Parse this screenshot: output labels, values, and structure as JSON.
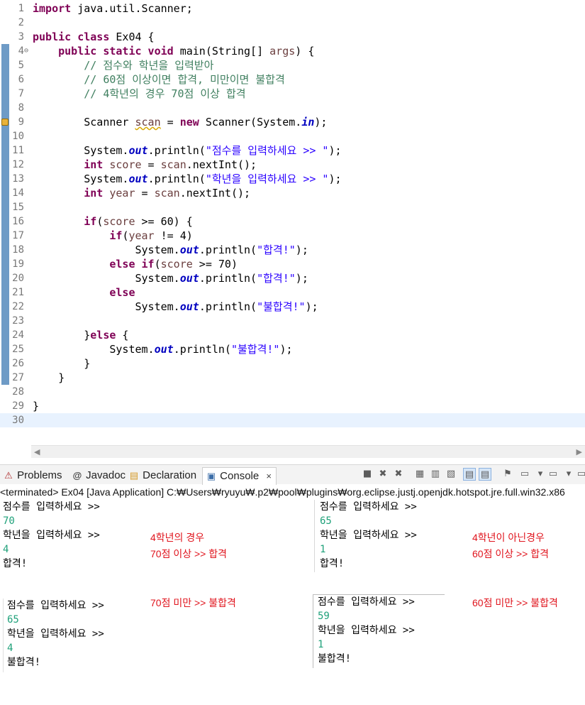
{
  "editor": {
    "lines": [
      {
        "n": "1",
        "tokens": [
          {
            "t": "import",
            "c": "kw"
          },
          {
            "t": " java.util.Scanner;",
            "c": ""
          }
        ]
      },
      {
        "n": "2",
        "tokens": []
      },
      {
        "n": "3",
        "tokens": [
          {
            "t": "public class",
            "c": "kw"
          },
          {
            "t": " Ex04 {",
            "c": ""
          }
        ]
      },
      {
        "n": "4",
        "fold": "⊖",
        "tokens": [
          {
            "t": "    ",
            "c": ""
          },
          {
            "t": "public static void",
            "c": "kw"
          },
          {
            "t": " main(String[] ",
            "c": ""
          },
          {
            "t": "args",
            "c": "var"
          },
          {
            "t": ") {",
            "c": ""
          }
        ]
      },
      {
        "n": "5",
        "tokens": [
          {
            "t": "        // 점수와 학년을 입력받아",
            "c": "cm"
          }
        ]
      },
      {
        "n": "6",
        "tokens": [
          {
            "t": "        // 60점 이상이면 합격, 미만이면 불합격",
            "c": "cm"
          }
        ]
      },
      {
        "n": "7",
        "tokens": [
          {
            "t": "        // 4학년의 경우 70점 이상 합격",
            "c": "cm"
          }
        ]
      },
      {
        "n": "8",
        "tokens": []
      },
      {
        "n": "9",
        "warn": true,
        "tokens": [
          {
            "t": "        Scanner ",
            "c": ""
          },
          {
            "t": "scan",
            "c": "var squiggle"
          },
          {
            "t": " = ",
            "c": ""
          },
          {
            "t": "new",
            "c": "kw"
          },
          {
            "t": " Scanner(System.",
            "c": ""
          },
          {
            "t": "in",
            "c": "fld"
          },
          {
            "t": ");",
            "c": ""
          }
        ]
      },
      {
        "n": "10",
        "tokens": []
      },
      {
        "n": "11",
        "tokens": [
          {
            "t": "        System.",
            "c": ""
          },
          {
            "t": "out",
            "c": "fld"
          },
          {
            "t": ".println(",
            "c": ""
          },
          {
            "t": "\"점수를 입력하세요 >> \"",
            "c": "st"
          },
          {
            "t": ");",
            "c": ""
          }
        ]
      },
      {
        "n": "12",
        "tokens": [
          {
            "t": "        ",
            "c": ""
          },
          {
            "t": "int",
            "c": "kw"
          },
          {
            "t": " ",
            "c": ""
          },
          {
            "t": "score",
            "c": "var"
          },
          {
            "t": " = ",
            "c": ""
          },
          {
            "t": "scan",
            "c": "var"
          },
          {
            "t": ".nextInt();",
            "c": ""
          }
        ]
      },
      {
        "n": "13",
        "tokens": [
          {
            "t": "        System.",
            "c": ""
          },
          {
            "t": "out",
            "c": "fld"
          },
          {
            "t": ".println(",
            "c": ""
          },
          {
            "t": "\"학년을 입력하세요 >> \"",
            "c": "st"
          },
          {
            "t": ");",
            "c": ""
          }
        ]
      },
      {
        "n": "14",
        "tokens": [
          {
            "t": "        ",
            "c": ""
          },
          {
            "t": "int",
            "c": "kw"
          },
          {
            "t": " ",
            "c": ""
          },
          {
            "t": "year",
            "c": "var"
          },
          {
            "t": " = ",
            "c": ""
          },
          {
            "t": "scan",
            "c": "var"
          },
          {
            "t": ".nextInt();",
            "c": ""
          }
        ]
      },
      {
        "n": "15",
        "tokens": []
      },
      {
        "n": "16",
        "tokens": [
          {
            "t": "        ",
            "c": ""
          },
          {
            "t": "if",
            "c": "kw"
          },
          {
            "t": "(",
            "c": ""
          },
          {
            "t": "score",
            "c": "var"
          },
          {
            "t": " >= 60) {",
            "c": ""
          }
        ]
      },
      {
        "n": "17",
        "tokens": [
          {
            "t": "            ",
            "c": ""
          },
          {
            "t": "if",
            "c": "kw"
          },
          {
            "t": "(",
            "c": ""
          },
          {
            "t": "year",
            "c": "var"
          },
          {
            "t": " != 4)",
            "c": ""
          }
        ]
      },
      {
        "n": "18",
        "tokens": [
          {
            "t": "                System.",
            "c": ""
          },
          {
            "t": "out",
            "c": "fld"
          },
          {
            "t": ".println(",
            "c": ""
          },
          {
            "t": "\"합격!\"",
            "c": "st"
          },
          {
            "t": ");",
            "c": ""
          }
        ]
      },
      {
        "n": "19",
        "tokens": [
          {
            "t": "            ",
            "c": ""
          },
          {
            "t": "else if",
            "c": "kw"
          },
          {
            "t": "(",
            "c": ""
          },
          {
            "t": "score",
            "c": "var"
          },
          {
            "t": " >= 70)",
            "c": ""
          }
        ]
      },
      {
        "n": "20",
        "tokens": [
          {
            "t": "                System.",
            "c": ""
          },
          {
            "t": "out",
            "c": "fld"
          },
          {
            "t": ".println(",
            "c": ""
          },
          {
            "t": "\"합격!\"",
            "c": "st"
          },
          {
            "t": ");",
            "c": ""
          }
        ]
      },
      {
        "n": "21",
        "tokens": [
          {
            "t": "            ",
            "c": ""
          },
          {
            "t": "else",
            "c": "kw"
          }
        ]
      },
      {
        "n": "22",
        "tokens": [
          {
            "t": "                System.",
            "c": ""
          },
          {
            "t": "out",
            "c": "fld"
          },
          {
            "t": ".println(",
            "c": ""
          },
          {
            "t": "\"불합격!\"",
            "c": "st"
          },
          {
            "t": ");",
            "c": ""
          }
        ]
      },
      {
        "n": "23",
        "tokens": []
      },
      {
        "n": "24",
        "tokens": [
          {
            "t": "        }",
            "c": ""
          },
          {
            "t": "else",
            "c": "kw"
          },
          {
            "t": " {",
            "c": ""
          }
        ]
      },
      {
        "n": "25",
        "tokens": [
          {
            "t": "            System.",
            "c": ""
          },
          {
            "t": "out",
            "c": "fld"
          },
          {
            "t": ".println(",
            "c": ""
          },
          {
            "t": "\"불합격!\"",
            "c": "st"
          },
          {
            "t": ");",
            "c": ""
          }
        ]
      },
      {
        "n": "26",
        "tokens": [
          {
            "t": "        }",
            "c": ""
          }
        ]
      },
      {
        "n": "27",
        "tokens": [
          {
            "t": "    }",
            "c": ""
          }
        ]
      },
      {
        "n": "28",
        "tokens": []
      },
      {
        "n": "29",
        "tokens": [
          {
            "t": "}",
            "c": ""
          }
        ]
      },
      {
        "n": "30",
        "current": true,
        "tokens": []
      }
    ],
    "changed_lines": [
      "4",
      "5",
      "6",
      "7",
      "8",
      "9",
      "10",
      "11",
      "12",
      "13",
      "14",
      "15",
      "16",
      "17",
      "18",
      "19",
      "20",
      "21",
      "22",
      "23",
      "24",
      "25",
      "26",
      "27"
    ]
  },
  "views": {
    "tabs": [
      {
        "label": "Problems",
        "icon": "problems-icon",
        "glyph": "⚠"
      },
      {
        "label": "Javadoc",
        "icon": "javadoc-icon",
        "glyph": "@"
      },
      {
        "label": "Declaration",
        "icon": "declaration-icon",
        "glyph": "▤"
      },
      {
        "label": "Console",
        "icon": "console-icon",
        "glyph": "▣",
        "active": true,
        "close": "×"
      }
    ],
    "toolbar": [
      {
        "name": "terminate-icon",
        "glyph": "■"
      },
      {
        "name": "remove-launch-icon",
        "glyph": "✖"
      },
      {
        "name": "remove-all-terminated-icon",
        "glyph": "✖"
      },
      {
        "name": "clear-console-icon",
        "glyph": "▦"
      },
      {
        "name": "scroll-lock-icon",
        "glyph": "▥"
      },
      {
        "name": "word-wrap-icon",
        "glyph": "▧"
      },
      {
        "name": "show-on-output-icon",
        "glyph": "▤",
        "pressed": true
      },
      {
        "name": "show-on-error-icon",
        "glyph": "▤",
        "pressed": true
      },
      {
        "name": "pin-console-icon",
        "glyph": "⚑"
      },
      {
        "name": "display-console-icon",
        "glyph": "▭"
      },
      {
        "name": "display-console-dropdown-icon",
        "glyph": "▾"
      },
      {
        "name": "open-console-icon",
        "glyph": "▭"
      },
      {
        "name": "open-console-dropdown-icon",
        "glyph": "▾"
      },
      {
        "name": "minimize-icon",
        "glyph": "▭"
      }
    ]
  },
  "console": {
    "status": "<terminated> Ex04 [Java Application] C:₩Users₩ryuyu₩.p2₩pool₩plugins₩org.eclipse.justj.openjdk.hotspot.jre.full.win32.x86"
  },
  "outputs": {
    "top_left": [
      {
        "t": "점수를 입력하세요 >>"
      },
      {
        "t": "70",
        "input": true
      },
      {
        "t": "학년을 입력하세요 >>"
      },
      {
        "t": "4",
        "input": true
      },
      {
        "t": "합격!"
      }
    ],
    "top_right": [
      {
        "t": "점수를 입력하세요 >>"
      },
      {
        "t": "65",
        "input": true
      },
      {
        "t": "학년을 입력하세요 >>"
      },
      {
        "t": "1",
        "input": true
      },
      {
        "t": "합격!"
      }
    ],
    "bottom_left": [
      {
        "t": "점수를 입력하세요 >>"
      },
      {
        "t": "65",
        "input": true
      },
      {
        "t": "학년을 입력하세요 >>"
      },
      {
        "t": "4",
        "input": true
      },
      {
        "t": "불합격!"
      }
    ],
    "bottom_right": [
      {
        "t": "점수를 입력하세요 >>"
      },
      {
        "t": "59",
        "input": true
      },
      {
        "t": "학년을 입력하세요 >>"
      },
      {
        "t": "1",
        "input": true
      },
      {
        "t": "불합격!"
      }
    ]
  },
  "notes": {
    "top_left": "4학년의 경우\n70점 이상 >> 합격",
    "top_right": "4학년이 아닌경우\n60점 이상 >> 합격",
    "bottom_left": "70점 미만 >> 불합격",
    "bottom_right": "60점 미만 >> 불합격"
  },
  "colors": {
    "keyword": "#7f0055",
    "comment": "#3f7f5f",
    "string": "#2a00ff",
    "field": "#0000c0",
    "variable": "#6a3e3e",
    "console_input": "#1fa17a",
    "annotation": "#e0141d"
  }
}
